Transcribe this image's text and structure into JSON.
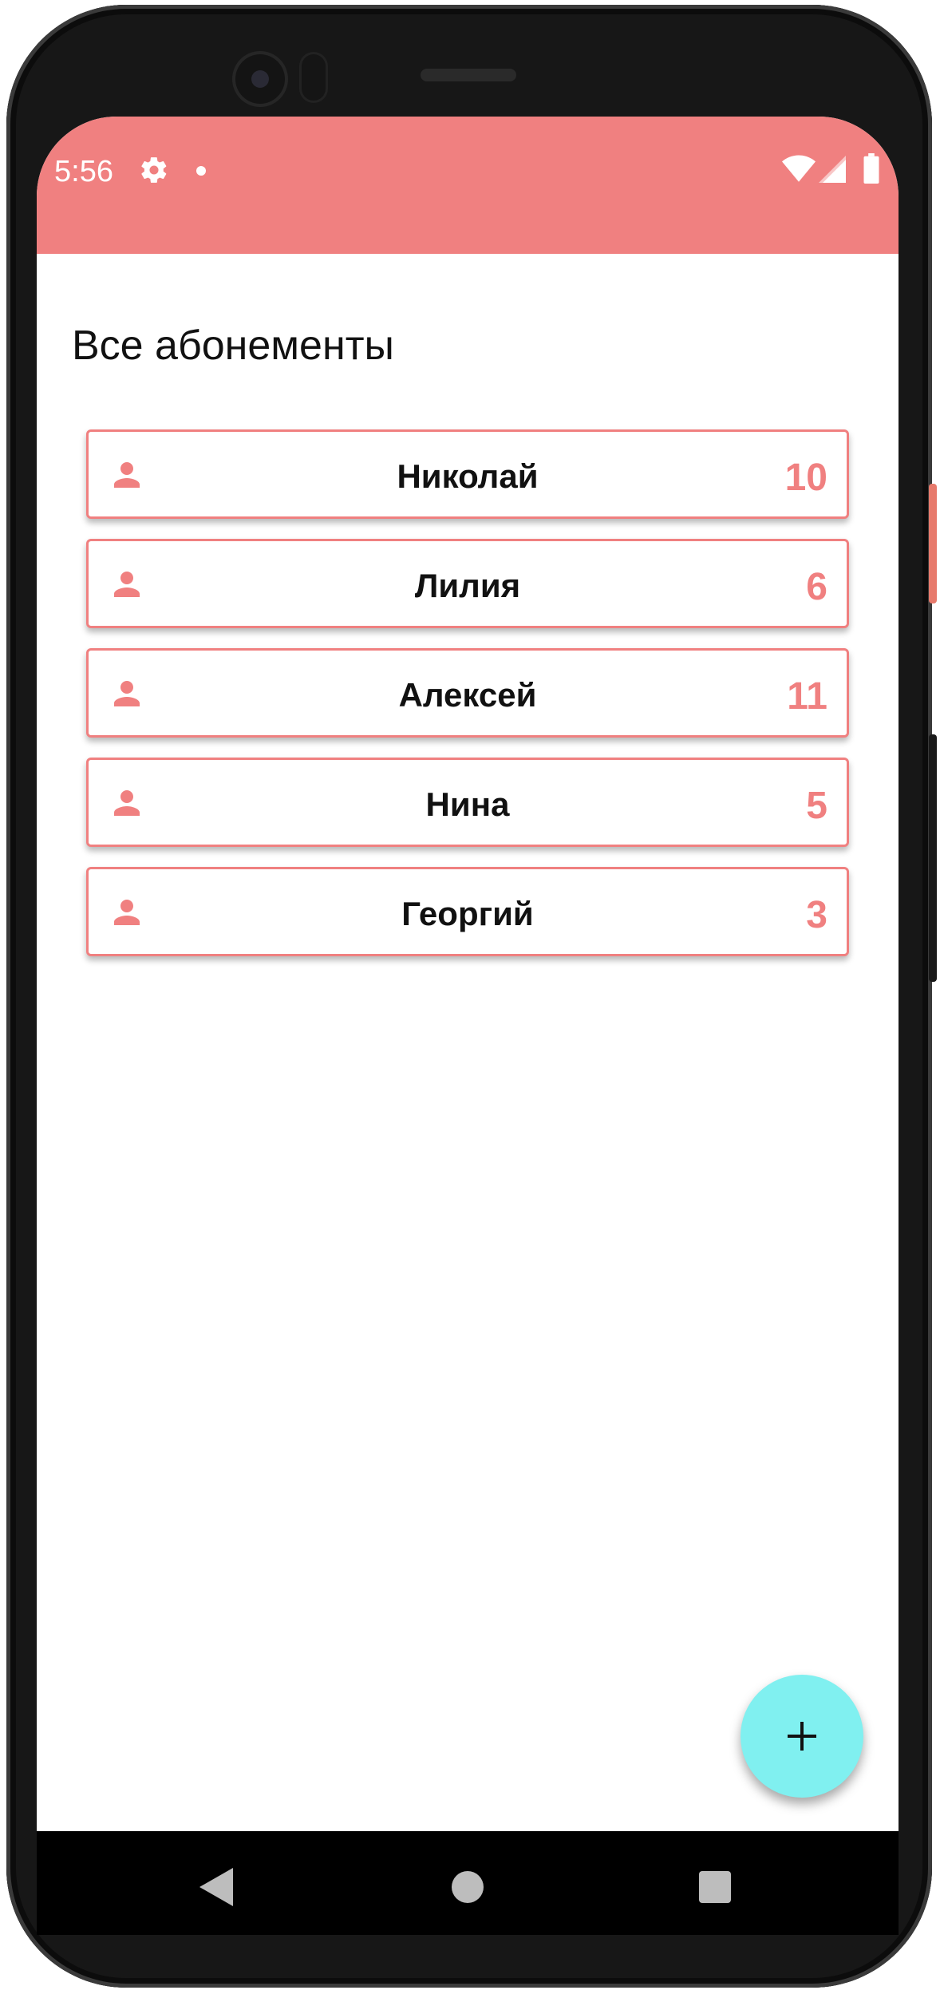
{
  "status_bar": {
    "time": "5:56",
    "icons": [
      "gear-icon",
      "notification-dot-icon",
      "wifi-icon",
      "signal-icon",
      "battery-icon"
    ],
    "color": "#f08080"
  },
  "page": {
    "title": "Все абонементы"
  },
  "subscriptions": [
    {
      "name": "Николай",
      "count": "10"
    },
    {
      "name": "Лилия",
      "count": "6"
    },
    {
      "name": "Алексей",
      "count": "11"
    },
    {
      "name": "Нина",
      "count": "5"
    },
    {
      "name": "Георгий",
      "count": "3"
    }
  ],
  "fab": {
    "icon": "plus-icon",
    "color": "#80f0f0"
  },
  "navigation": {
    "icons": [
      "back-icon",
      "home-icon",
      "recents-icon"
    ]
  },
  "colors": {
    "accent": "#f08080",
    "fab": "#80f0f0"
  }
}
